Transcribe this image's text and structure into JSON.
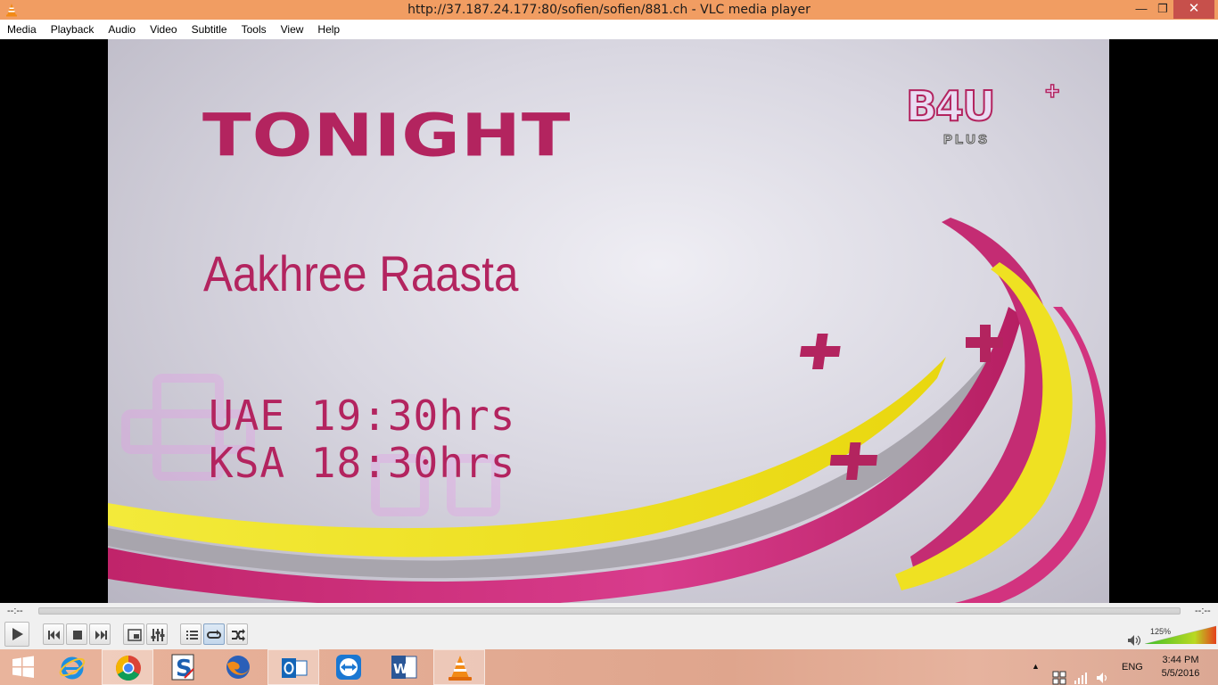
{
  "window": {
    "title": "http://37.187.24.177:80/sofien/sofien/881.ch - VLC media player",
    "app_icon": "vlc-cone-icon",
    "buttons": {
      "minimize": "minimize-icon",
      "restore": "restore-icon",
      "close": "close-icon"
    }
  },
  "menu": {
    "items": [
      "Media",
      "Playback",
      "Audio",
      "Video",
      "Subtitle",
      "Tools",
      "View",
      "Help"
    ]
  },
  "video": {
    "headline": "TONIGHT",
    "show_title": "Aakhree Raasta",
    "schedule_uae": "UAE 19:30hrs",
    "schedule_ksa": "KSA 18:30hrs",
    "logo_text": "B4U",
    "logo_plus": "+",
    "logo_sub": "PLUS",
    "colors": {
      "magenta": "#b3245f",
      "yellow": "#f0e11e",
      "pink": "#e24a97",
      "background": "#dcd9e3"
    }
  },
  "seek": {
    "elapsed": "--:--",
    "total": "--:--",
    "progress": 0
  },
  "controls": {
    "buttons": [
      "play-icon",
      "previous-icon",
      "stop-icon",
      "next-icon",
      "fullscreen-icon",
      "extended-settings-icon",
      "playlist-icon",
      "loop-icon",
      "shuffle-icon"
    ],
    "volume_percent": "125%",
    "volume_level": 1.25
  },
  "taskbar": {
    "apps": [
      "windows-start-icon",
      "internet-explorer-icon",
      "chrome-icon",
      "app-s-icon",
      "firefox-icon",
      "outlook-icon",
      "teamviewer-icon",
      "word-icon",
      "vlc-icon"
    ],
    "active_app": "vlc-icon",
    "language": "ENG",
    "time": "3:44 PM",
    "date": "5/5/2016"
  }
}
